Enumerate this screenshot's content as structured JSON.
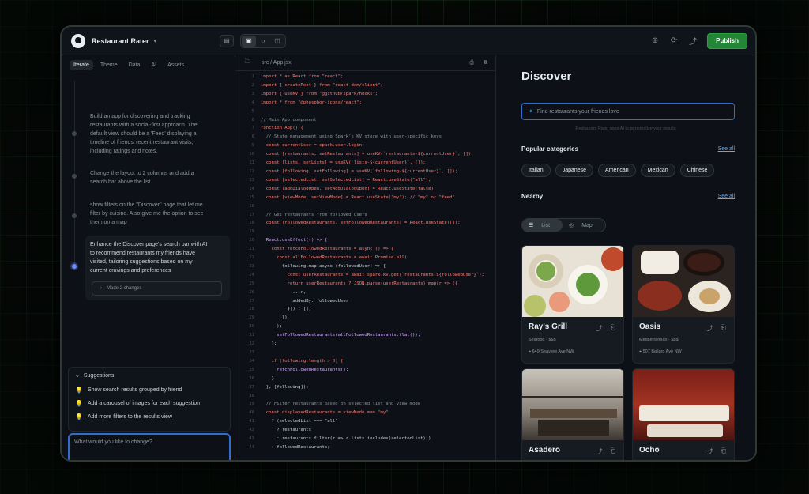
{
  "app": {
    "title": "Restaurant Rater",
    "publish_label": "Publish"
  },
  "left": {
    "tabs": [
      "Iterate",
      "Theme",
      "Data",
      "AI",
      "Assets"
    ],
    "messages": [
      "Build an app for discovering and tracking restaurants with a social-first approach. The default view should be a 'Feed' displaying a timeline of friends' recent restaurant visits, including ratings and notes.",
      "Change the layout to 2 columns and add a search bar above the list",
      "show filters on the \"Discover\" page that let me filter by cuisine. Also give me the option to see them on a map",
      "Enhance the Discover page's search bar with AI to recommend restaurants my friends have visited, tailoring suggestions based on my current cravings and preferences"
    ],
    "changes_label": "Made 2 changes",
    "suggestions": {
      "title": "Suggestions",
      "items": [
        "Show search results grouped by friend",
        "Add a carousel of images for each suggestion",
        "Add more filters to the results view"
      ]
    },
    "prompt_placeholder": "What would you like to change?"
  },
  "code": {
    "file": "src / App.jsx",
    "lines": [
      "import * as React from \"react\";",
      "import { createRoot } from \"react-dom/client\";",
      "import { useKV } from \"@github/spark/hooks\";",
      "import * from \"@phosphor-icons/react\";",
      "",
      "// Main App component",
      "function App() {",
      "  // State management using Spark's KV store with user-specific keys",
      "  const currentUser = spark.user.login;",
      "  const [restaurants, setRestaurants] = useKV(`restaurants-${currentUser}`, []);",
      "  const [lists, setLists] = useKV(`lists-${currentUser}`, []);",
      "  const [following, setFollowing] = useKV(`following-${currentUser}`, []);",
      "  const [selectedList, setSelectedList] = React.useState(\"all\");",
      "  const [addDialogOpen, setAddDialogOpen] = React.useState(false);",
      "  const [viewMode, setViewMode] = React.useState(\"my\"); // \"my\" or \"feed\"",
      "",
      "  // Get restaurants from followed users",
      "  const [followedRestaurants, setFollowedRestaurants] = React.useState([]);",
      "",
      "  React.useEffect(() => {",
      "    const fetchFollowedRestaurants = async () => {",
      "      const allFollowedRestaurants = await Promise.all(",
      "        following.map(async (followedUser) => {",
      "          const userRestaurants = await spark.kv.get(`restaurants-${followedUser}`);",
      "          return userRestaurants ? JSON.parse(userRestaurants).map(r => ({",
      "            ...r,",
      "            addedBy: followedUser",
      "          })) : [];",
      "        })",
      "      );",
      "      setFollowedRestaurants(allFollowedRestaurants.flat());",
      "    };",
      "",
      "    if (following.length > 0) {",
      "      fetchFollowedRestaurants();",
      "    }",
      "  }, [following]);",
      "",
      "  // Filter restaurants based on selected list and view mode",
      "  const displayedRestaurants = viewMode === \"my\"",
      "    ? (selectedList === \"all\"",
      "      ? restaurants",
      "      : restaurants.filter(r => r.lists.includes(selectedList)))",
      "    : followedRestaurants;"
    ]
  },
  "preview": {
    "title": "Discover",
    "search_placeholder": "Find restaurants your friends love",
    "search_hint": "Restaurant Rater uses AI to personalize your results",
    "popular_title": "Popular categories",
    "see_all": "See all",
    "categories": [
      "Italian",
      "Japanese",
      "American",
      "Mexican",
      "Chinese"
    ],
    "nearby_title": "Nearby",
    "view_toggle": [
      "List",
      "Map"
    ],
    "cards": [
      {
        "name": "Ray's Grill",
        "meta": "Seafood · $$$",
        "address": "649 Seaview Ave NW"
      },
      {
        "name": "Oasis",
        "meta": "Mediterranean · $$$",
        "address": "507 Ballard Ave NW"
      },
      {
        "name": "Asadero",
        "meta": "",
        "address": ""
      },
      {
        "name": "Ocho",
        "meta": "",
        "address": ""
      }
    ]
  },
  "colors": {
    "accent": "#238636",
    "focus": "#316dca",
    "link": "#58a6ff"
  }
}
